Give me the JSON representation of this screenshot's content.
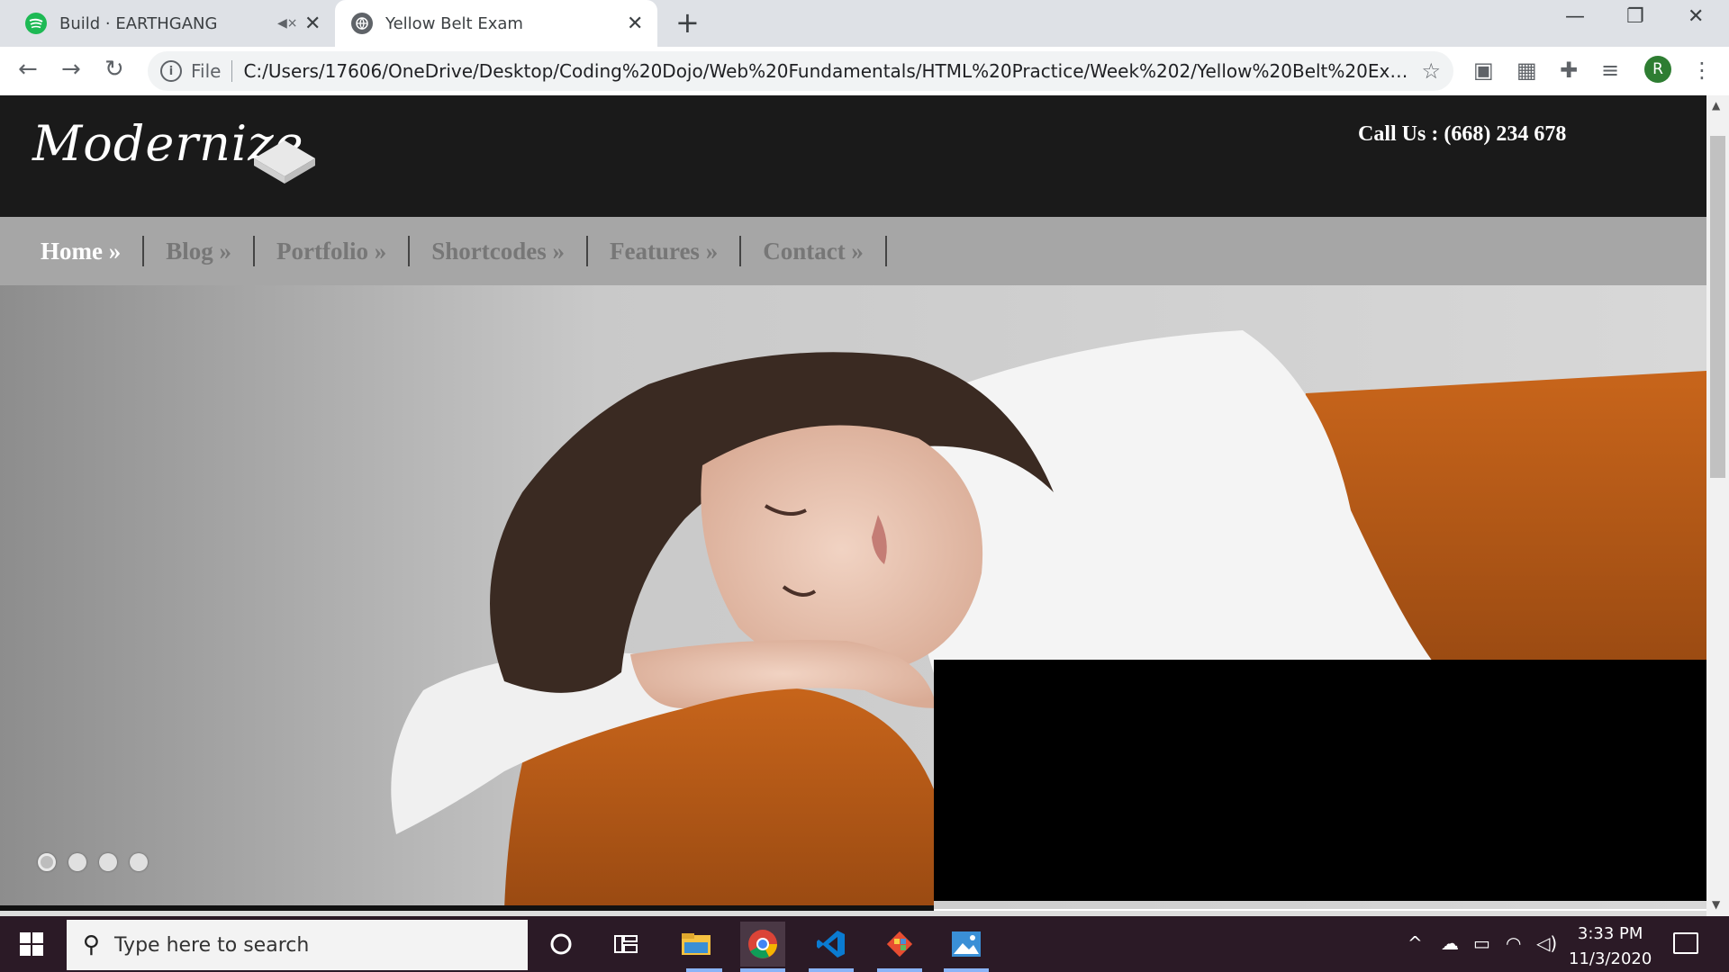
{
  "browser": {
    "tabs": [
      {
        "title": "Build · EARTHGANG",
        "icon": "spotify-icon",
        "muted_icon": "speaker-mute-icon"
      },
      {
        "title": "Yellow Belt Exam",
        "icon": "globe-icon"
      }
    ],
    "address": {
      "scheme_label": "File",
      "url": "C:/Users/17606/OneDrive/Desktop/Coding%20Dojo/Web%20Fundamentals/HTML%20Practice/Week%202/Yellow%20Belt%20Exam/Yello..."
    },
    "profile_initial": "R"
  },
  "site": {
    "logo": "Modernize",
    "call_us": "Call Us : (668) 234 678",
    "nav": [
      "Home »",
      "Blog »",
      "Portfolio »",
      "Shortcodes »",
      "Features »",
      "Contact »"
    ],
    "active_nav": "Home »",
    "slider": {
      "slide_count": 4,
      "active_index": 0
    },
    "colors": {
      "header_bg": "#1a1a1a",
      "nav_bg": "#a6a6a6",
      "sofa": "#c8651b"
    }
  },
  "taskbar": {
    "search_placeholder": "Type here to search",
    "time": "3:33 PM",
    "date": "11/3/2020",
    "apps": [
      "cortana-icon",
      "task-view-icon",
      "file-explorer-icon",
      "chrome-icon",
      "vscode-icon",
      "git-icon",
      "photos-icon"
    ]
  }
}
